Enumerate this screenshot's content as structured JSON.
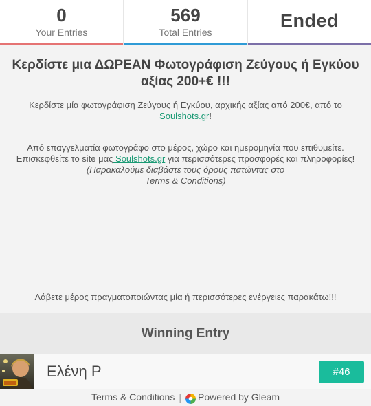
{
  "colors": {
    "your_entries_bar": "#e57373",
    "total_entries_bar": "#2f9bd6",
    "ended_bar": "#7b6fa8",
    "link": "#1a9a74",
    "badge": "#1abc9c"
  },
  "stats": {
    "your_entries": {
      "value": "0",
      "label": "Your Entries"
    },
    "total_entries": {
      "value": "569",
      "label": "Total Entries"
    },
    "status": {
      "value": "Ended"
    }
  },
  "description": {
    "title": "Κερδίστε μια ΔΩΡΕΑΝ Φωτογράφιση Ζεύγους ή Εγκύου αξίας 200+€ !!!",
    "para1_text": "Κερδίστε μία φωτογράφιση Ζεύγους ή Εγκύου, αρχικής αξίας από 200",
    "para1_bold": "€",
    "para1_mid": ", από το ",
    "para1_link": "Soulshots.gr",
    "para1_end": "!",
    "para2_line1": "Από επαγγελματία φωτογράφο στο μέρος, χώρο και ημερομηνία που επιθυμείτε.",
    "para2_line2_pre": "Επισκεφθείτε το site μας",
    "para2_link": " Soulshots.gr",
    "para2_line2_post": " για περισσότερες προσφορές και πληροφορίες!",
    "para2_italic1": "(Παρακαλούμε διαβάστε τους όρους πατώντας στο",
    "para2_italic2": "Terms & Conditions)",
    "cta": "Λάβετε μέρος πραγματοποιώντας μία ή περισσότερες ενέργειες παρακάτω!!!"
  },
  "winning": {
    "heading": "Winning Entry",
    "name": "Ελένη Ρ",
    "entry_number": "#46",
    "avatar_icon": "winner-avatar-photo"
  },
  "footer": {
    "terms": "Terms & Conditions",
    "separator": "|",
    "powered": "Powered by Gleam",
    "logo_icon": "gleam-logo-icon"
  }
}
